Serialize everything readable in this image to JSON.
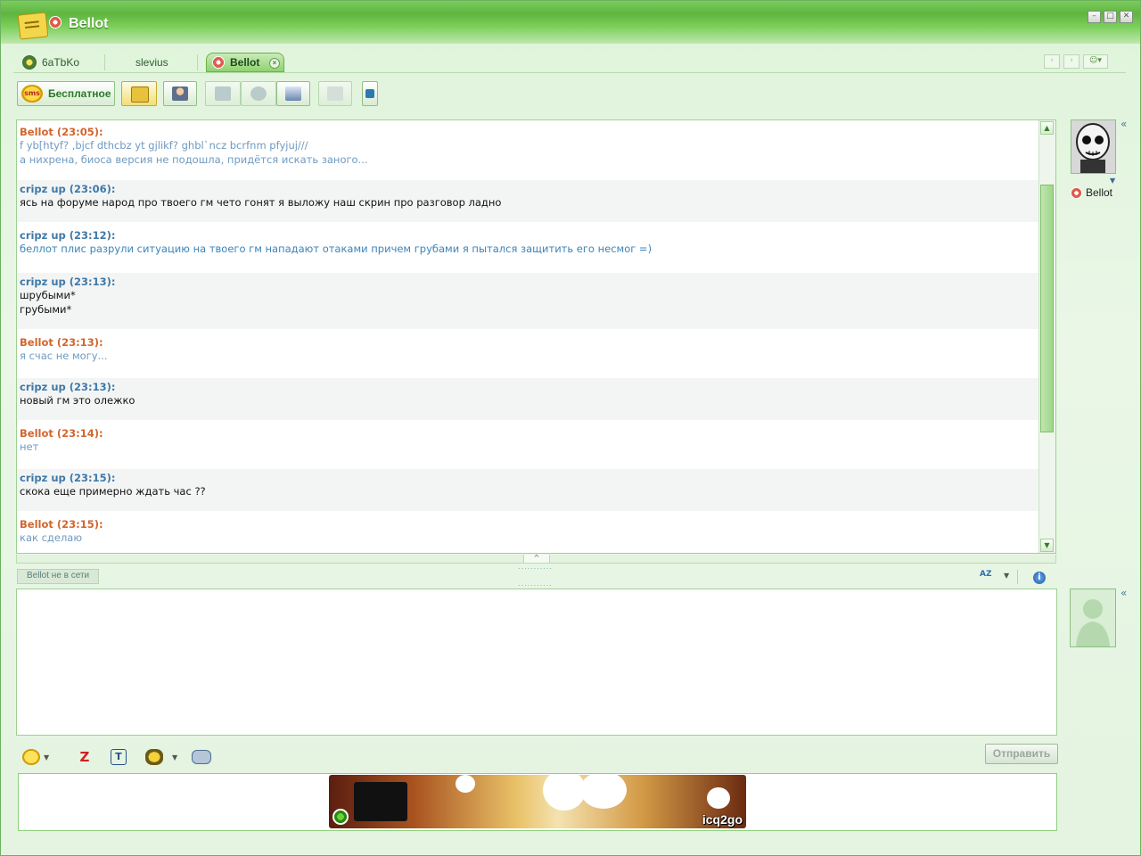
{
  "window": {
    "title": "Bellot",
    "controls": [
      "minimize-icon",
      "maximize-icon",
      "close-icon"
    ]
  },
  "tabs": [
    {
      "label": "6aTbKo",
      "icon": "user-status-icon"
    },
    {
      "label": "slevius"
    },
    {
      "label": "Bellot",
      "icon": "flower-status-icon",
      "active": true
    }
  ],
  "toolbar": {
    "sms_label": "Бесплатное",
    "sms_icon_text": "sms",
    "buttons": [
      "message-icon",
      "contact-info-icon",
      "call-icon",
      "voice-icon",
      "fax-icon",
      "file-icon",
      "external-icon"
    ]
  },
  "history": {
    "messages": [
      {
        "author": "Bellot (23:05):",
        "kind": "bellot",
        "lines": [
          "f yb[htyf? ,bjcf dthcbz yt gjlikf? ghbl`ncz bcrfnm pfyjuj///",
          "а нихрена, биоса версия не подошла, придётся искать заного..."
        ]
      },
      {
        "author": "cripz up (23:06):",
        "kind": "cripz",
        "lines": [
          "ясь на форуме народ про твоего гм чето гонят я выложу наш скрин про разговор ладно"
        ]
      },
      {
        "author": "cripz up (23:12):",
        "kind": "cripz-blue",
        "lines": [
          "беллот плис разрули ситуацию на твоего гм нападают отаками причем грубами я пытался защитить его несмог =)"
        ]
      },
      {
        "author": "cripz up (23:13):",
        "kind": "cripz",
        "lines": [
          "шрубыми*",
          "грубыми*"
        ]
      },
      {
        "author": "Bellot (23:13):",
        "kind": "bellot",
        "lines": [
          "я счас не могу..."
        ]
      },
      {
        "author": "cripz up (23:13):",
        "kind": "cripz",
        "lines": [
          "новый гм это олежко"
        ]
      },
      {
        "author": "Bellot (23:14):",
        "kind": "bellot",
        "lines": [
          "нет"
        ]
      },
      {
        "author": "cripz up (23:15):",
        "kind": "cripz",
        "lines": [
          "скока еще примерно ждать час ??"
        ]
      },
      {
        "author": "Bellot (23:15):",
        "kind": "bellot",
        "lines": [
          "как сделаю"
        ]
      }
    ]
  },
  "status": {
    "offline_text": "Bellot не в сети",
    "spell_text": "AZ"
  },
  "contact": {
    "name": "Bellot"
  },
  "compose": {
    "send_label": "Отправить",
    "bottom_tools": [
      "smiley-icon",
      "zap-icon",
      "text-format-icon",
      "bee-icon",
      "gamepad-icon"
    ]
  },
  "ad": {
    "logo_text": "icq2go"
  },
  "colors": {
    "bellot_name": "#d2652c",
    "cripz_name": "#3f79a8",
    "accent_green": "#5fb53f"
  }
}
